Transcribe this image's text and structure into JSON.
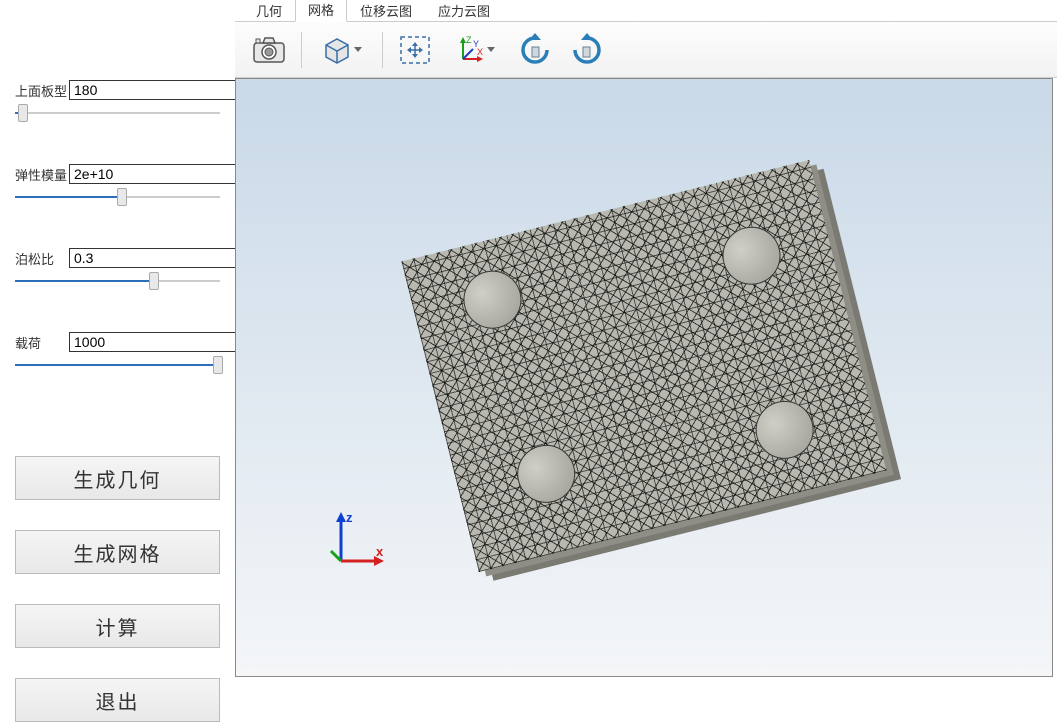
{
  "sidebar": {
    "params": [
      {
        "label": "上面板型",
        "value": "180",
        "slider_pct": 4
      },
      {
        "label": "弹性模量",
        "value": "2e+10",
        "slider_pct": 52
      },
      {
        "label": "泊松比",
        "value": "0.3",
        "slider_pct": 68
      },
      {
        "label": "载荷",
        "value": "1000",
        "slider_pct": 99
      }
    ],
    "buttons": {
      "gen_geometry": "生成几何",
      "gen_mesh": "生成网格",
      "compute": "计算",
      "exit": "退出"
    }
  },
  "tabs": {
    "items": [
      "几何",
      "网格",
      "位移云图",
      "应力云图"
    ],
    "active_index": 1
  },
  "toolbar": {
    "icons": {
      "camera": "camera-icon",
      "cube": "cube-view-icon",
      "fit": "fit-view-icon",
      "axes": "axes-icon",
      "rotate_ccw": "rotate-ccw-icon",
      "rotate_cw": "rotate-cw-icon"
    }
  },
  "triad": {
    "x": "x",
    "y": "Y",
    "z": "z",
    "x_full": "X",
    "z_full": "Z"
  }
}
